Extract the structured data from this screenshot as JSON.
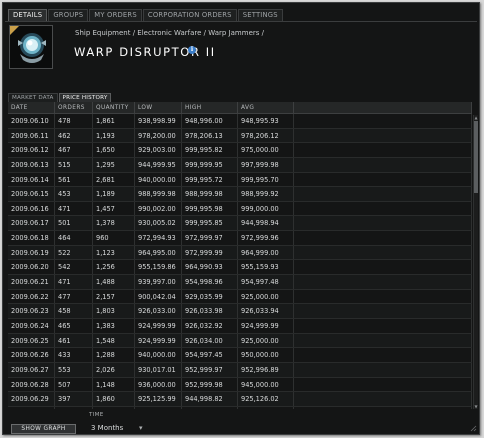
{
  "top_tabs": [
    "DETAILS",
    "GROUPS",
    "MY ORDERS",
    "CORPORATION ORDERS",
    "SETTINGS"
  ],
  "breadcrumb": "Ship Equipment / Electronic Warfare / Warp Jammers /",
  "item_title": "WARP DISRUPTOR II",
  "info_icon": "i",
  "sub_tabs": [
    "MARKET DATA",
    "PRICE HISTORY"
  ],
  "table": {
    "headers": [
      "DATE",
      "ORDERS",
      "QUANTITY",
      "LOW",
      "HIGH",
      "AVG"
    ],
    "rows": [
      [
        "2009.06.10",
        "478",
        "1,861",
        "938,998.99",
        "948,996.00",
        "948,995.93"
      ],
      [
        "2009.06.11",
        "462",
        "1,193",
        "978,200.00",
        "978,206.13",
        "978,206.12"
      ],
      [
        "2009.06.12",
        "467",
        "1,650",
        "929,003.00",
        "999,995.82",
        "975,000.00"
      ],
      [
        "2009.06.13",
        "515",
        "1,295",
        "944,999.95",
        "999,999.95",
        "997,999.98"
      ],
      [
        "2009.06.14",
        "561",
        "2,681",
        "940,000.00",
        "999,995.72",
        "999,995.70"
      ],
      [
        "2009.06.15",
        "453",
        "1,189",
        "988,999.98",
        "988,999.98",
        "988,999.92"
      ],
      [
        "2009.06.16",
        "471",
        "1,457",
        "990,002.00",
        "999,995.98",
        "999,000.00"
      ],
      [
        "2009.06.17",
        "501",
        "1,378",
        "930,005.02",
        "999,995.85",
        "944,998.94"
      ],
      [
        "2009.06.18",
        "464",
        "960",
        "972,994.93",
        "972,999.97",
        "972,999.96"
      ],
      [
        "2009.06.19",
        "522",
        "1,123",
        "964,995.00",
        "972,999.99",
        "964,999.00"
      ],
      [
        "2009.06.20",
        "542",
        "1,256",
        "955,159.86",
        "964,990.93",
        "955,159.93"
      ],
      [
        "2009.06.21",
        "471",
        "1,488",
        "939,997.00",
        "954,998.96",
        "954,997.48"
      ],
      [
        "2009.06.22",
        "477",
        "2,157",
        "900,042.04",
        "929,035.99",
        "925,000.00"
      ],
      [
        "2009.06.23",
        "458",
        "1,803",
        "926,033.00",
        "926,033.98",
        "926,033.94"
      ],
      [
        "2009.06.24",
        "465",
        "1,383",
        "924,999.99",
        "926,032.92",
        "924,999.99"
      ],
      [
        "2009.06.25",
        "461",
        "1,548",
        "924,999.99",
        "926,034.00",
        "925,000.00"
      ],
      [
        "2009.06.26",
        "433",
        "1,288",
        "940,000.00",
        "954,997.45",
        "950,000.00"
      ],
      [
        "2009.06.27",
        "553",
        "2,026",
        "930,017.01",
        "952,999.97",
        "952,996.89"
      ],
      [
        "2009.06.28",
        "507",
        "1,148",
        "936,000.00",
        "952,999.98",
        "945,000.00"
      ],
      [
        "2009.06.29",
        "397",
        "1,860",
        "925,125.99",
        "944,998.82",
        "925,126.02"
      ],
      [
        "2009.06.30",
        "452",
        "1,719",
        "944,998.82",
        "944,998.92",
        "944,998.99"
      ]
    ]
  },
  "time_label": "TIME",
  "show_graph_label": "SHOW GRAPH",
  "time_value": "3 Months",
  "colors": {
    "accent_info": "#3c7ec9",
    "window_bg": "#141515"
  }
}
